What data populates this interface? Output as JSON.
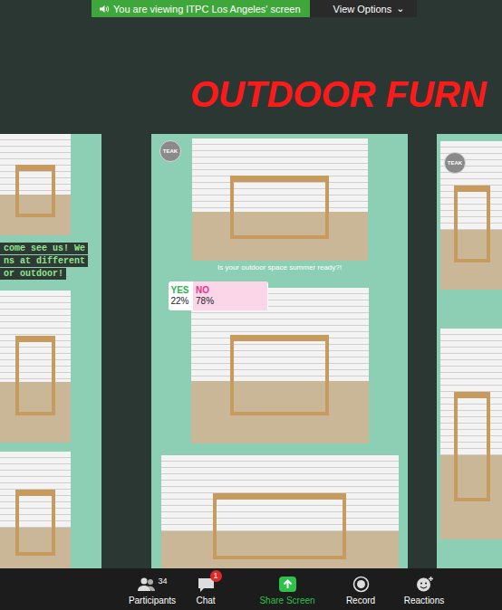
{
  "banner": {
    "message": "You are viewing ITPC Los Angeles' screen",
    "view_options": "View Options",
    "view_options_icon": "⌄"
  },
  "heading": "OUTDOOR FURN",
  "left_story": {
    "caption_lines": [
      "come see us! We",
      "ns at different",
      "or outdoor!"
    ]
  },
  "middle_story": {
    "avatar": "TEAK",
    "caption": "Is your outdoor space summer ready?!",
    "poll": [
      {
        "label": "YES",
        "percent": "22%",
        "level": 0.22,
        "color": "#2bb34a"
      },
      {
        "label": "NO",
        "percent": "78%",
        "level": 0.78,
        "color": "#e6348a"
      }
    ]
  },
  "right_story": {
    "avatar": "TEAK"
  },
  "toolbar": [
    {
      "kind": "participants",
      "label": "Participants",
      "count": "34"
    },
    {
      "kind": "chat",
      "label": "Chat",
      "badge": "1"
    },
    {
      "kind": "share",
      "label": "Share Screen"
    },
    {
      "kind": "record",
      "label": "Record"
    },
    {
      "kind": "reactions",
      "label": "Reactions"
    }
  ]
}
